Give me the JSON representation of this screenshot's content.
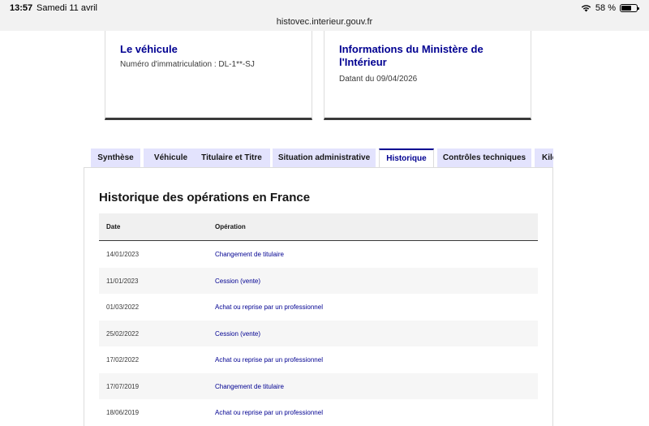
{
  "status_bar": {
    "time": "13:57",
    "date": "Samedi 11 avril",
    "battery": "58 %"
  },
  "browser": {
    "url": "histovec.interieur.gouv.fr"
  },
  "cards": {
    "vehicle": {
      "title": "Le véhicule",
      "subtitle": "Numéro d'immatriculation : DL-1**-SJ"
    },
    "ministry": {
      "title": "Informations du Ministère de l'Intérieur",
      "subtitle": "Datant du 09/04/2026"
    }
  },
  "tabs": [
    {
      "label": "Synthèse"
    },
    {
      "label": "Véhicule"
    },
    {
      "label": "Titulaire et Titre"
    },
    {
      "label": "Situation administrative"
    },
    {
      "label": "Historique",
      "active": true
    },
    {
      "label": "Contrôles techniques"
    },
    {
      "label": "Kilo"
    }
  ],
  "history": {
    "title": "Historique des opérations en France",
    "columns": [
      "Date",
      "Opération"
    ],
    "rows": [
      {
        "date": "14/01/2023",
        "operation": "Changement de titulaire"
      },
      {
        "date": "11/01/2023",
        "operation": "Cession (vente)"
      },
      {
        "date": "01/03/2022",
        "operation": "Achat ou reprise par un professionnel"
      },
      {
        "date": "25/02/2022",
        "operation": "Cession (vente)"
      },
      {
        "date": "17/02/2022",
        "operation": "Achat ou reprise par un professionnel"
      },
      {
        "date": "17/07/2019",
        "operation": "Changement de titulaire"
      },
      {
        "date": "18/06/2019",
        "operation": "Achat ou reprise par un professionnel"
      }
    ]
  }
}
